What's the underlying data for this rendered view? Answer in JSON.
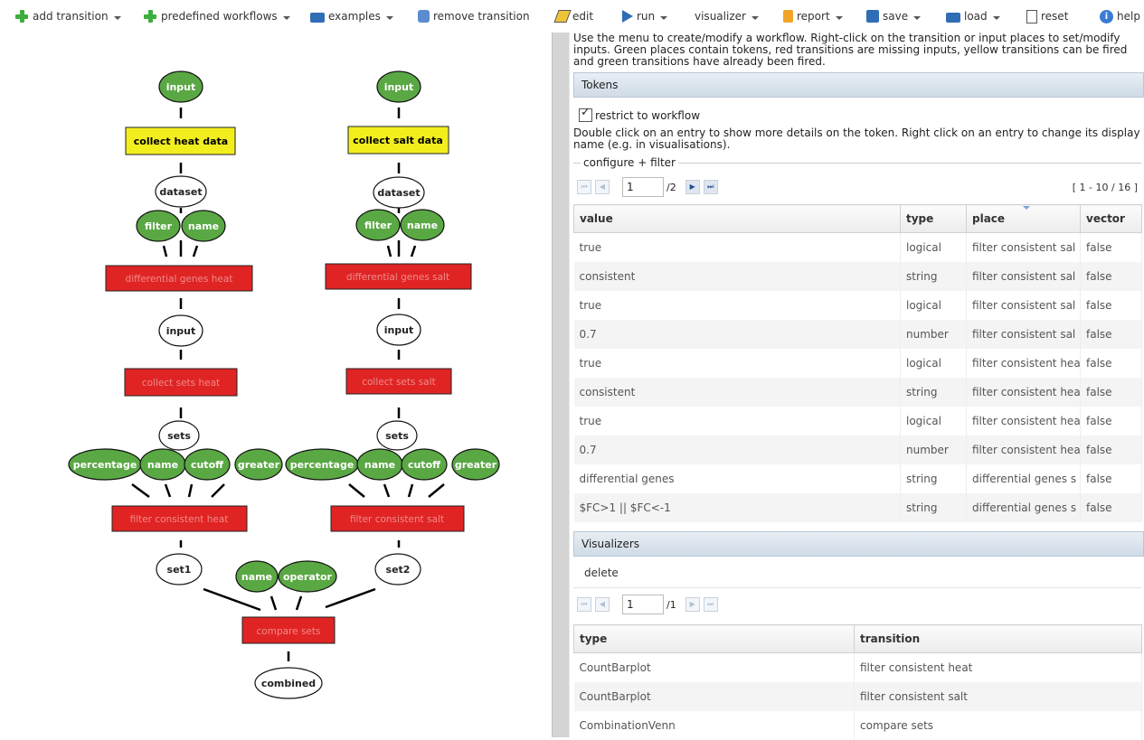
{
  "toolbar": {
    "add_transition": "add transition",
    "predefined_workflows": "predefined workflows",
    "examples": "examples",
    "remove_transition": "remove transition",
    "edit": "edit",
    "run": "run",
    "visualizer": "visualizer",
    "report": "report",
    "save": "save",
    "load": "load",
    "reset": "reset",
    "help": "help"
  },
  "colors": {
    "place_green": "#5aa844",
    "transition_yellow": "#f2ee1e",
    "transition_red": "#e02424",
    "panel_header": "#cfdbe7"
  },
  "workflow": {
    "left": {
      "input": "input",
      "collect": "collect heat data",
      "dataset": "dataset",
      "filter": "filter",
      "name": "name",
      "diff": "differential genes heat",
      "input2": "input",
      "collect_sets": "collect sets heat",
      "sets": "sets",
      "percentage": "percentage",
      "name2": "name",
      "cutoff": "cutoff",
      "greater": "greater",
      "filter_consistent": "filter consistent heat",
      "set": "set1"
    },
    "right": {
      "input": "input",
      "collect": "collect salt data",
      "dataset": "dataset",
      "filter": "filter",
      "name": "name",
      "diff": "differential genes salt",
      "input2": "input",
      "collect_sets": "collect sets salt",
      "sets": "sets",
      "percentage": "percentage",
      "name2": "name",
      "cutoff": "cutoff",
      "greater": "greater",
      "filter_consistent": "filter consistent salt",
      "set": "set2"
    },
    "compare": {
      "name": "name",
      "operator": "operator",
      "transition": "compare sets",
      "combined": "combined"
    }
  },
  "intro": "Use the menu to create/modify a workflow. Right-click on the transition or input places to set/modify inputs. Green places contain tokens, red transitions are missing inputs, yellow transitions can be fired and green transitions have already been fired.",
  "tokens": {
    "title": "Tokens",
    "restrict_label": "restrict to workflow",
    "note": "Double click on an entry to show more details on the token. Right click on an entry to change its display name (e.g. in visualisations).",
    "configure": "configure + filter",
    "page": "1",
    "page_total": "/2",
    "range": "[ 1 - 10 / 16 ]",
    "columns": [
      "value",
      "type",
      "place",
      "vector"
    ],
    "rows": [
      [
        "true",
        "logical",
        "filter consistent sal",
        "false"
      ],
      [
        "consistent",
        "string",
        "filter consistent sal",
        "false"
      ],
      [
        "true",
        "logical",
        "filter consistent sal",
        "false"
      ],
      [
        "0.7",
        "number",
        "filter consistent sal",
        "false"
      ],
      [
        "true",
        "logical",
        "filter consistent heа",
        "false"
      ],
      [
        "consistent",
        "string",
        "filter consistent heа",
        "false"
      ],
      [
        "true",
        "logical",
        "filter consistent heа",
        "false"
      ],
      [
        "0.7",
        "number",
        "filter consistent heа",
        "false"
      ],
      [
        "differential genes",
        "string",
        "differential genes s",
        "false"
      ],
      [
        "$FC>1 || $FC<-1",
        "string",
        "differential genes s",
        "false"
      ]
    ]
  },
  "visualizers": {
    "title": "Visualizers",
    "delete": "delete",
    "page": "1",
    "page_total": "/1",
    "columns": [
      "type",
      "transition"
    ],
    "rows": [
      [
        "CountBarplot",
        "filter consistent heat"
      ],
      [
        "CountBarplot",
        "filter consistent salt"
      ],
      [
        "CombinationVenn",
        "compare sets"
      ]
    ]
  }
}
